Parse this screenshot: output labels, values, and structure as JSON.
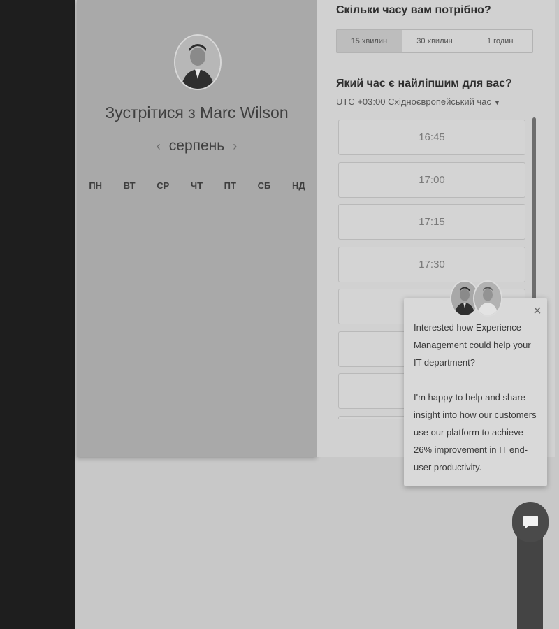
{
  "host": {
    "name": "Marc Wilson",
    "meet_title": "Зустрітися з Marc Wilson"
  },
  "calendar": {
    "month": "серпень",
    "prev_icon": "‹",
    "next_icon": "›",
    "weekdays": [
      "ПН",
      "ВТ",
      "СР",
      "ЧТ",
      "ПТ",
      "СБ",
      "НД"
    ]
  },
  "duration": {
    "question": "Скільки часу вам потрібно?",
    "options": [
      "15 хвилин",
      "30 хвилин",
      "1 годин"
    ],
    "selected": "15 хвилин"
  },
  "time": {
    "question": "Який час є найліпшим для вас?",
    "timezone": "UTC +03:00 Східноєвропейський час",
    "slots": [
      "16:45",
      "17:00",
      "17:15",
      "17:30",
      "",
      "",
      ""
    ]
  },
  "popup": {
    "close_icon": "×",
    "paragraph1": "Interested how Experience Management could help your IT department?",
    "paragraph2": "I'm happy to help and share insight into how our customers use our platform to achieve 26% improvement in IT end-user productivity."
  },
  "icons": {
    "chat": "chat-bubble-icon",
    "close": "close-icon",
    "caret": "caret-down-icon"
  },
  "colors": {
    "card_left": "#a9a9a9",
    "card_right": "#d1d1d1",
    "sidebar": "#1e1e1e"
  }
}
